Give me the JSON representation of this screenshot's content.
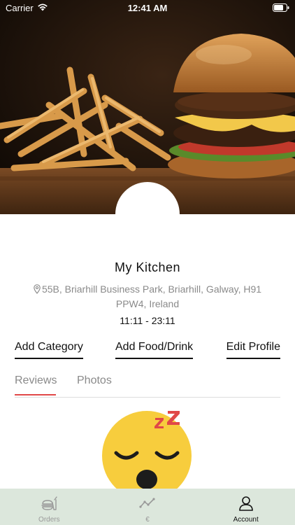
{
  "status_bar": {
    "carrier": "Carrier",
    "time": "12:41 AM"
  },
  "hero": {
    "image": "burger-and-fries-photo"
  },
  "kitchen": {
    "name": "My Kitchen",
    "address": "55B, Briarhill Business Park, Briarhill, Galway, H91 PPW4, Ireland",
    "hours": "11:11 - 23:11"
  },
  "actions": {
    "add_category": "Add Category",
    "add_food_drink": "Add Food/Drink",
    "edit_profile": "Edit Profile"
  },
  "tabs": [
    {
      "label": "Reviews",
      "active": true
    },
    {
      "label": "Photos",
      "active": false
    }
  ],
  "empty_state": {
    "icon": "sleeping-face-emoji"
  },
  "tab_bar": [
    {
      "label": "Orders",
      "icon": "food-order-icon",
      "active": false
    },
    {
      "label": "€",
      "icon": "trend-line-icon",
      "active": false
    },
    {
      "label": "Account",
      "icon": "person-icon",
      "active": true
    }
  ],
  "colors": {
    "accent": "#e04848",
    "tab_bar_bg": "#dce7dc",
    "muted_text": "#8a8a8a"
  }
}
